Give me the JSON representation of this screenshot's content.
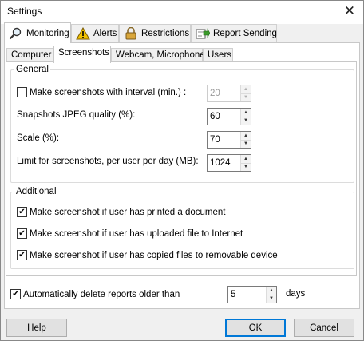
{
  "window": {
    "title": "Settings"
  },
  "outer_tabs": [
    {
      "label": "Monitoring",
      "icon": "magnifier-icon",
      "active": true
    },
    {
      "label": "Alerts",
      "icon": "warning-icon"
    },
    {
      "label": "Restrictions",
      "icon": "lock-icon"
    },
    {
      "label": "Report Sending",
      "icon": "send-report-icon"
    }
  ],
  "inner_tabs": [
    {
      "label": "Computer"
    },
    {
      "label": "Screenshots",
      "active": true
    },
    {
      "label": "Webcam, Microphone"
    },
    {
      "label": "Users"
    }
  ],
  "general": {
    "legend": "General",
    "interval": {
      "label": "Make screenshots with interval (min.) :",
      "checked": false,
      "value": "20",
      "enabled": false
    },
    "jpeg_quality": {
      "label": "Snapshots JPEG quality (%):",
      "value": "60"
    },
    "scale": {
      "label": "Scale (%):",
      "value": "70"
    },
    "limit": {
      "label": "Limit for screenshots, per user per day (MB):",
      "value": "1024"
    }
  },
  "additional": {
    "legend": "Additional",
    "options": [
      {
        "label": "Make screenshot if user has printed a document",
        "checked": true
      },
      {
        "label": "Make screenshot if user has uploaded file to Internet",
        "checked": true
      },
      {
        "label": "Make screenshot if user has copied files to removable device",
        "checked": true
      }
    ]
  },
  "auto_delete": {
    "label": "Automatically delete reports older than",
    "checked": true,
    "value": "5",
    "unit": "days"
  },
  "buttons": {
    "help": "Help",
    "ok": "OK",
    "cancel": "Cancel"
  },
  "colors": {
    "accent": "#0078d7",
    "warning": "#f2c200",
    "send": "#3a9a2a"
  }
}
